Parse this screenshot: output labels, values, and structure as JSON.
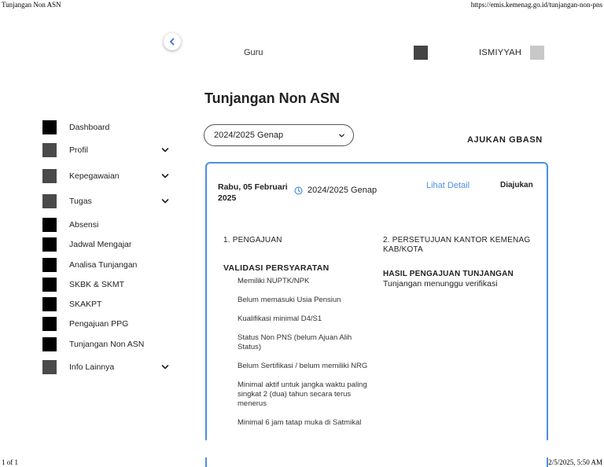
{
  "print": {
    "title": "Tunjangan Non ASN",
    "url": "https://emis.kemenag.go.id/tunjangan-non-pns",
    "page": "1 of 1",
    "datetime": "2/5/2025, 5:50 AM"
  },
  "topbar": {
    "role": "Guru",
    "user": "ISMIYYAH"
  },
  "sidebar": {
    "items": [
      {
        "label": "Dashboard",
        "icon": "dashboard-icon"
      },
      {
        "label": "Profil",
        "icon": "profile-icon",
        "expandable": true
      },
      {
        "label": "Kepegawaian",
        "icon": "briefcase-icon",
        "expandable": true
      },
      {
        "label": "Tugas",
        "icon": "task-icon",
        "expandable": true
      },
      {
        "label": "Absensi",
        "icon": "attendance-icon"
      },
      {
        "label": "Jadwal Mengajar",
        "icon": "calendar-icon"
      },
      {
        "label": "Analisa Tunjangan",
        "icon": "analysis-icon"
      },
      {
        "label": "SKBK & SKMT",
        "icon": "document-icon"
      },
      {
        "label": "SKAKPT",
        "icon": "document-icon"
      },
      {
        "label": "Pengajuan PPG",
        "icon": "form-icon"
      },
      {
        "label": "Tunjangan Non ASN",
        "icon": "money-icon"
      },
      {
        "label": "Info Lainnya",
        "icon": "info-icon",
        "expandable": true
      }
    ]
  },
  "main": {
    "title": "Tunjangan Non ASN",
    "semester_selected": "2024/2025 Genap",
    "ajukan_label": "AJUKAN GBASN",
    "card": {
      "date": "Rabu, 05 Februari 2025",
      "semester": "2024/2025 Genap",
      "detail_label": "Lihat Detail",
      "status": "Diajukan",
      "step1": "1. PENGAJUAN",
      "step2": "2. PERSETUJUAN KANTOR KEMENAG KAB/KOTA",
      "validation_title": "VALIDASI PERSYARATAN",
      "requirements": [
        "Memiliki NUPTK/NPK",
        "Belum memasuki Usia Pensiun",
        "Kualifikasi minimal D4/S1",
        "Status Non PNS (belum Ajuan Alih Status)",
        "Belum Sertifikasi / belum memiliki NRG",
        "Minimal aktif untuk jangka waktu paling singkat 2 (dua) tahun secara terus menerus",
        "Minimal 6 jam tatap muka di Satmikal"
      ],
      "result_title": "HASIL PENGAJUAN TUNJANGAN",
      "result_text": "Tunjangan menunggu verifikasi"
    }
  }
}
